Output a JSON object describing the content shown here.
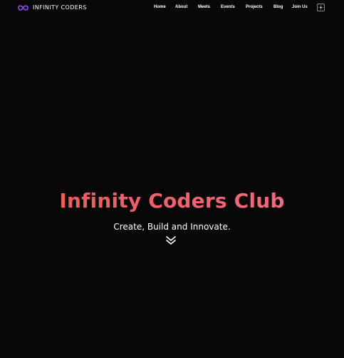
{
  "brand": {
    "name": "INFINITY CODERS",
    "logo_icon": "infinity-icon",
    "logo_color": "#8a4fe0"
  },
  "nav": {
    "items": [
      {
        "label": "Home"
      },
      {
        "label": "About"
      },
      {
        "label": "Meets"
      },
      {
        "label": "Events"
      },
      {
        "label": "Projects"
      },
      {
        "label": "Blog"
      },
      {
        "label": "Join Us"
      }
    ],
    "theme_toggle_icon": "theme-toggle-icon"
  },
  "hero": {
    "title": "Infinity Coders Club",
    "subtitle": "Create, Build and Innovate.",
    "scroll_icon": "double-chevron-down-icon",
    "title_gradient": [
      "#f25a4e",
      "#f06e8a"
    ]
  },
  "colors": {
    "background": "#070707",
    "text": "#ffffff"
  }
}
